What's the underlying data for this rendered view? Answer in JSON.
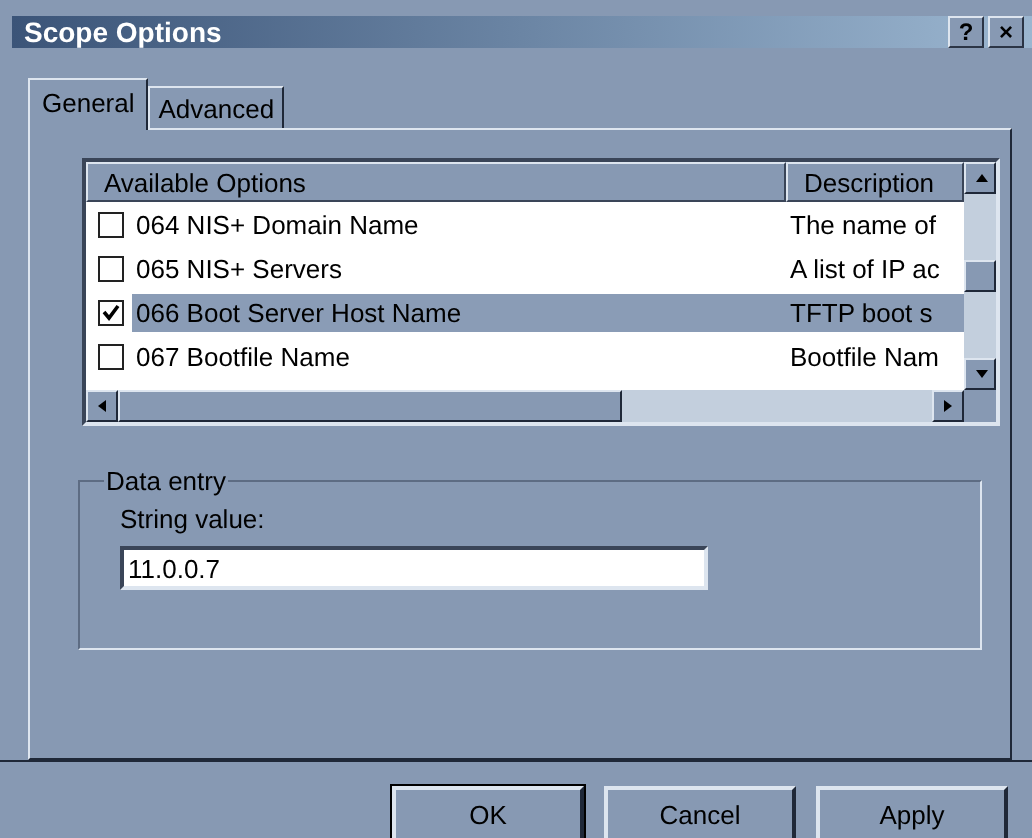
{
  "window": {
    "title": "Scope Options",
    "buttons": [
      "?",
      "×"
    ]
  },
  "tabs": [
    {
      "label": "General",
      "selected": true
    },
    {
      "label": "Advanced",
      "selected": false
    }
  ],
  "options_list": {
    "columns": [
      "Available Options",
      "Description"
    ],
    "rows": [
      {
        "option": "064 NIS+ Domain Name",
        "description": "The name of",
        "checked": false,
        "selected": false
      },
      {
        "option": "065 NIS+ Servers",
        "description": "A list of IP ac",
        "checked": false,
        "selected": false
      },
      {
        "option": "066 Boot Server Host Name",
        "description": "TFTP boot s",
        "checked": true,
        "selected": true
      },
      {
        "option": "067 Bootfile Name",
        "description": "Bootfile Nam",
        "checked": false,
        "selected": false
      }
    ]
  },
  "data_entry": {
    "title": "Data entry",
    "label": "String value:",
    "value": "11.0.0.7"
  },
  "buttons": [
    "OK",
    "Cancel",
    "Apply"
  ]
}
